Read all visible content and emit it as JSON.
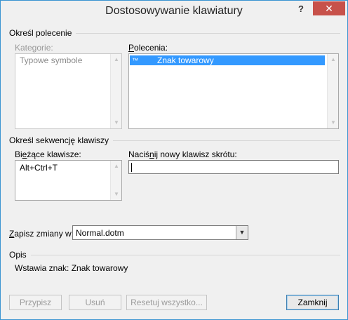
{
  "window": {
    "title": "Dostosowywanie klawiatury",
    "help_glyph": "?",
    "close_glyph": "✕"
  },
  "command_section": {
    "heading": "Określ polecenie",
    "categories_label": "Kategorie:",
    "categories": [
      "Typowe symbole"
    ],
    "commands_label": "Polecenia:",
    "commands": [
      {
        "symbol": "™",
        "name": "Znak towarowy",
        "selected": true
      }
    ]
  },
  "keys_section": {
    "heading": "Określ sekwencję klawiszy",
    "current_keys_label": "Bieżące klawisze:",
    "current_keys": [
      "Alt+Ctrl+T"
    ],
    "new_key_label": "Naciśnij nowy klawisz skrótu:",
    "new_key_value": ""
  },
  "save_in": {
    "label": "Zapisz zmiany w:",
    "value": "Normal.dotm"
  },
  "description": {
    "heading": "Opis",
    "text": "Wstawia znak: Znak towarowy"
  },
  "buttons": {
    "assign": "Przypisz",
    "remove": "Usuń",
    "reset_all": "Resetuj wszystko...",
    "close": "Zamknij"
  },
  "colors": {
    "selection": "#3399ff",
    "close_button": "#c7514a",
    "window_border": "#3a94d1"
  }
}
